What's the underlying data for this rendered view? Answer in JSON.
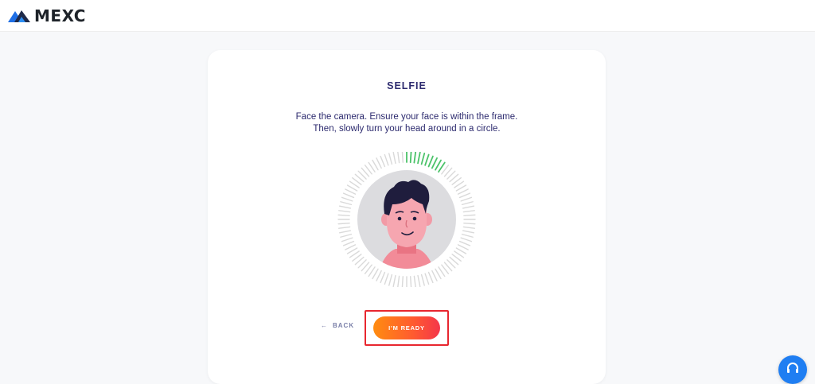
{
  "header": {
    "brand": "MEXC"
  },
  "selfie": {
    "title": "SELFIE",
    "instruction_line1": "Face the camera. Ensure your face is within the frame.",
    "instruction_line2": "Then, slowly turn your head around in a circle.",
    "progress_fraction": 0.1
  },
  "actions": {
    "back_arrow": "←",
    "back_label": "BACK",
    "ready_label": "I'M READY"
  },
  "colors": {
    "brand_blue": "#1f7ef2",
    "title_navy": "#2c2a6e",
    "progress_green": "#4cc36a",
    "tick_grey": "#d9d9d9",
    "button_orange": "#ff8c10",
    "button_red": "#f4364a",
    "highlight_red": "#e8262f"
  },
  "icons": {
    "logo": "mexc-mountain-icon",
    "help": "headset-icon",
    "back": "arrow-left-icon"
  }
}
